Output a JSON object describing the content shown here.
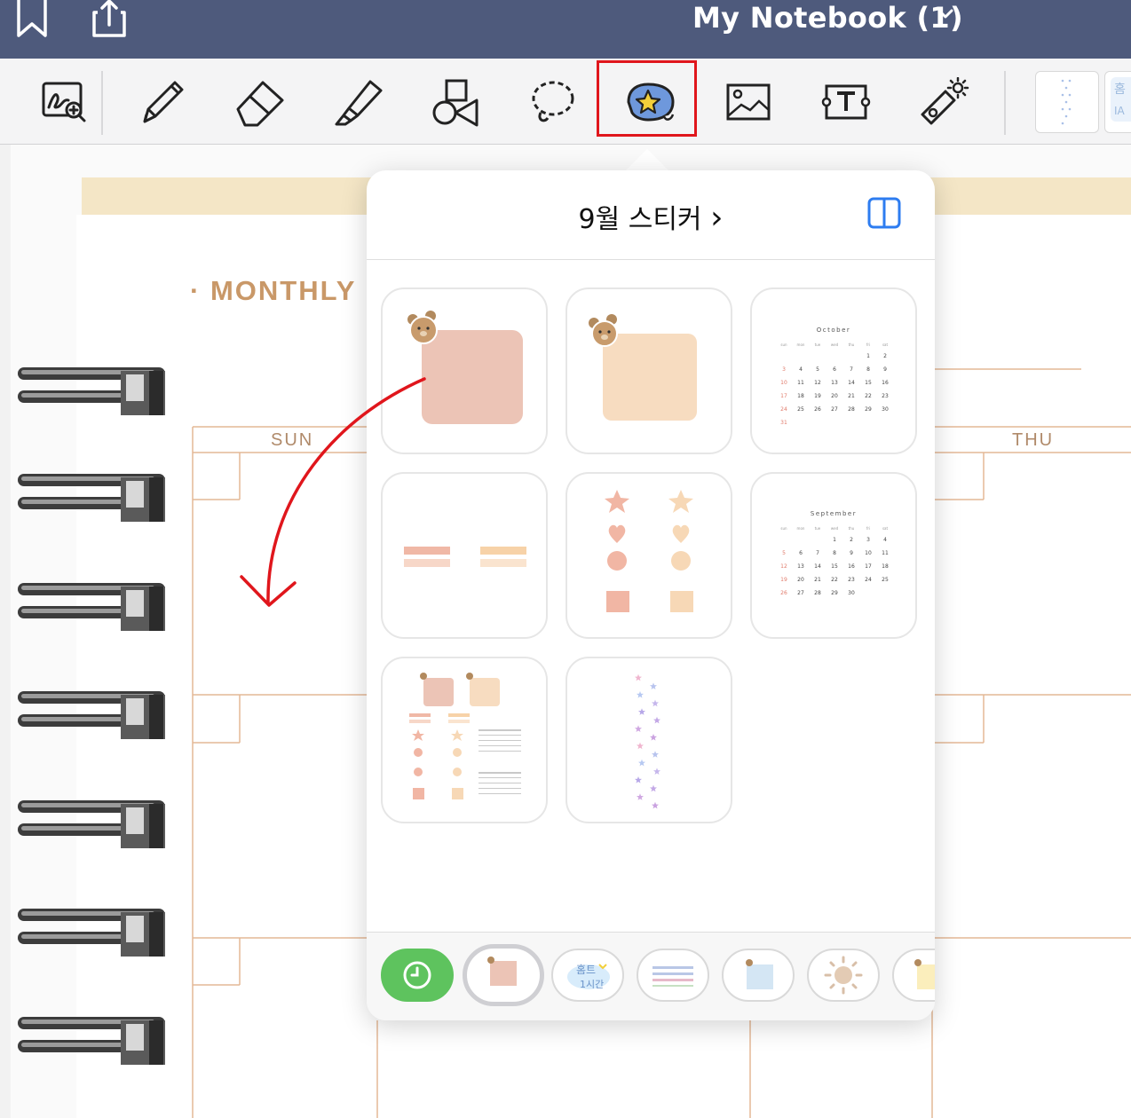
{
  "header": {
    "notebook_title": "My Notebook (1)"
  },
  "toolbar": {
    "tools": [
      {
        "name": "zoom-handwriting"
      },
      {
        "name": "pen"
      },
      {
        "name": "eraser"
      },
      {
        "name": "highlighter"
      },
      {
        "name": "shapes"
      },
      {
        "name": "lasso"
      },
      {
        "name": "sticker",
        "selected": true
      },
      {
        "name": "image"
      },
      {
        "name": "text"
      },
      {
        "name": "laser-pointer"
      }
    ],
    "highlight_color": "#e0161c"
  },
  "page": {
    "heading_dot": "·",
    "heading": "MONTHLY",
    "day_sun": "SUN",
    "day_thu": "THU"
  },
  "popover": {
    "title": "9월 스티커",
    "chevron": "›",
    "stickers": [
      "pink-memo-bear",
      "peach-memo-bear",
      "october-calendar",
      "label-tapes",
      "star-heart-circle-square",
      "september-calendar",
      "sticker-sheet-preview",
      "purple-stars-strip"
    ],
    "calendar_october": {
      "title": "October",
      "weekdays": [
        "sun",
        "mon",
        "tue",
        "wed",
        "thu",
        "fri",
        "sat"
      ],
      "weeks": [
        [
          "",
          "",
          "",
          "",
          "",
          "1",
          "2"
        ],
        [
          "3",
          "4",
          "5",
          "6",
          "7",
          "8",
          "9"
        ],
        [
          "10",
          "11",
          "12",
          "13",
          "14",
          "15",
          "16"
        ],
        [
          "17",
          "18",
          "19",
          "20",
          "21",
          "22",
          "23"
        ],
        [
          "24",
          "25",
          "26",
          "27",
          "28",
          "29",
          "30"
        ],
        [
          "31",
          "",
          "",
          "",
          "",
          "",
          ""
        ]
      ]
    },
    "calendar_september": {
      "title": "September",
      "weekdays": [
        "sun",
        "mon",
        "tue",
        "wed",
        "thu",
        "fri",
        "sat"
      ],
      "weeks": [
        [
          "",
          "",
          "",
          "1",
          "2",
          "3",
          "4"
        ],
        [
          "5",
          "6",
          "7",
          "8",
          "9",
          "10",
          "11"
        ],
        [
          "12",
          "13",
          "14",
          "15",
          "16",
          "17",
          "18"
        ],
        [
          "19",
          "20",
          "21",
          "22",
          "23",
          "24",
          "25"
        ],
        [
          "26",
          "27",
          "28",
          "29",
          "30",
          "",
          ""
        ]
      ]
    },
    "tray": {
      "items": [
        "recent-clock",
        "pink-memo-set",
        "korean-lettering-set",
        "label-grid-set",
        "blue-memo-set",
        "sun-set",
        "yellow-memo-set"
      ],
      "recent_color": "#5ec35e"
    }
  }
}
